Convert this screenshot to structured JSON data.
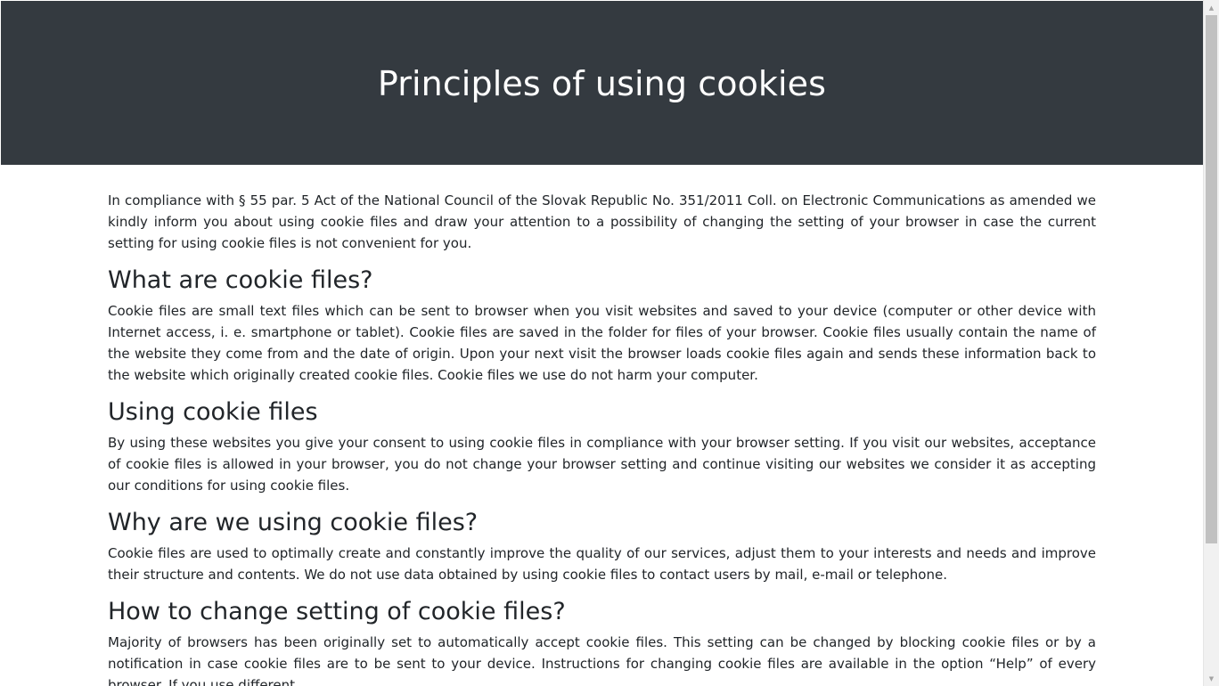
{
  "hero": {
    "title": "Principles of using cookies"
  },
  "intro": "In compliance with § 55 par. 5 Act of the National Council of the Slovak Republic No. 351/2011 Coll. on Electronic Communications as amended we kindly inform you about using cookie files and draw your attention to a possibility of changing the setting of your browser in case the current setting for using cookie files is not convenient for you.",
  "sections": [
    {
      "heading": "What are cookie files?",
      "body": "Cookie files are small text files which can be sent to browser when you visit websites and saved to your device (computer or other device with Internet access, i. e. smartphone or tablet). Cookie files are saved in the folder for files of your browser. Cookie files usually contain the name of the website they come from and the date of origin. Upon your next visit the browser loads cookie files again and sends these information back to the website which originally created cookie files. Cookie files we use do not harm your computer."
    },
    {
      "heading": "Using cookie files",
      "body": "By using these websites you give your consent to using cookie files in compliance with your browser setting. If you visit our websites, acceptance of cookie files is allowed in your browser, you do not change your browser setting and continue visiting our websites we consider it as accepting our conditions for using cookie files."
    },
    {
      "heading": "Why are we using cookie files?",
      "body": "Cookie files are used to optimally create and constantly improve the quality of our services, adjust them to your interests and needs and improve their structure and contents. We do not use data obtained by using cookie files to contact users by mail, e-mail or telephone."
    },
    {
      "heading": "How to change setting of cookie files?",
      "body": "Majority of browsers has been originally set to automatically accept cookie files. This setting can be changed by blocking cookie files or by a notification in case cookie files are to be sent to your device. Instructions for changing cookie files are available in the option “Help” of every browser. If you use different"
    }
  ],
  "scrollbar": {
    "up_icon": "scroll-up-arrow",
    "down_icon": "scroll-down-arrow"
  },
  "colors": {
    "hero_bg": "#343a40",
    "hero_text": "#ffffff",
    "body_text": "#212529"
  }
}
